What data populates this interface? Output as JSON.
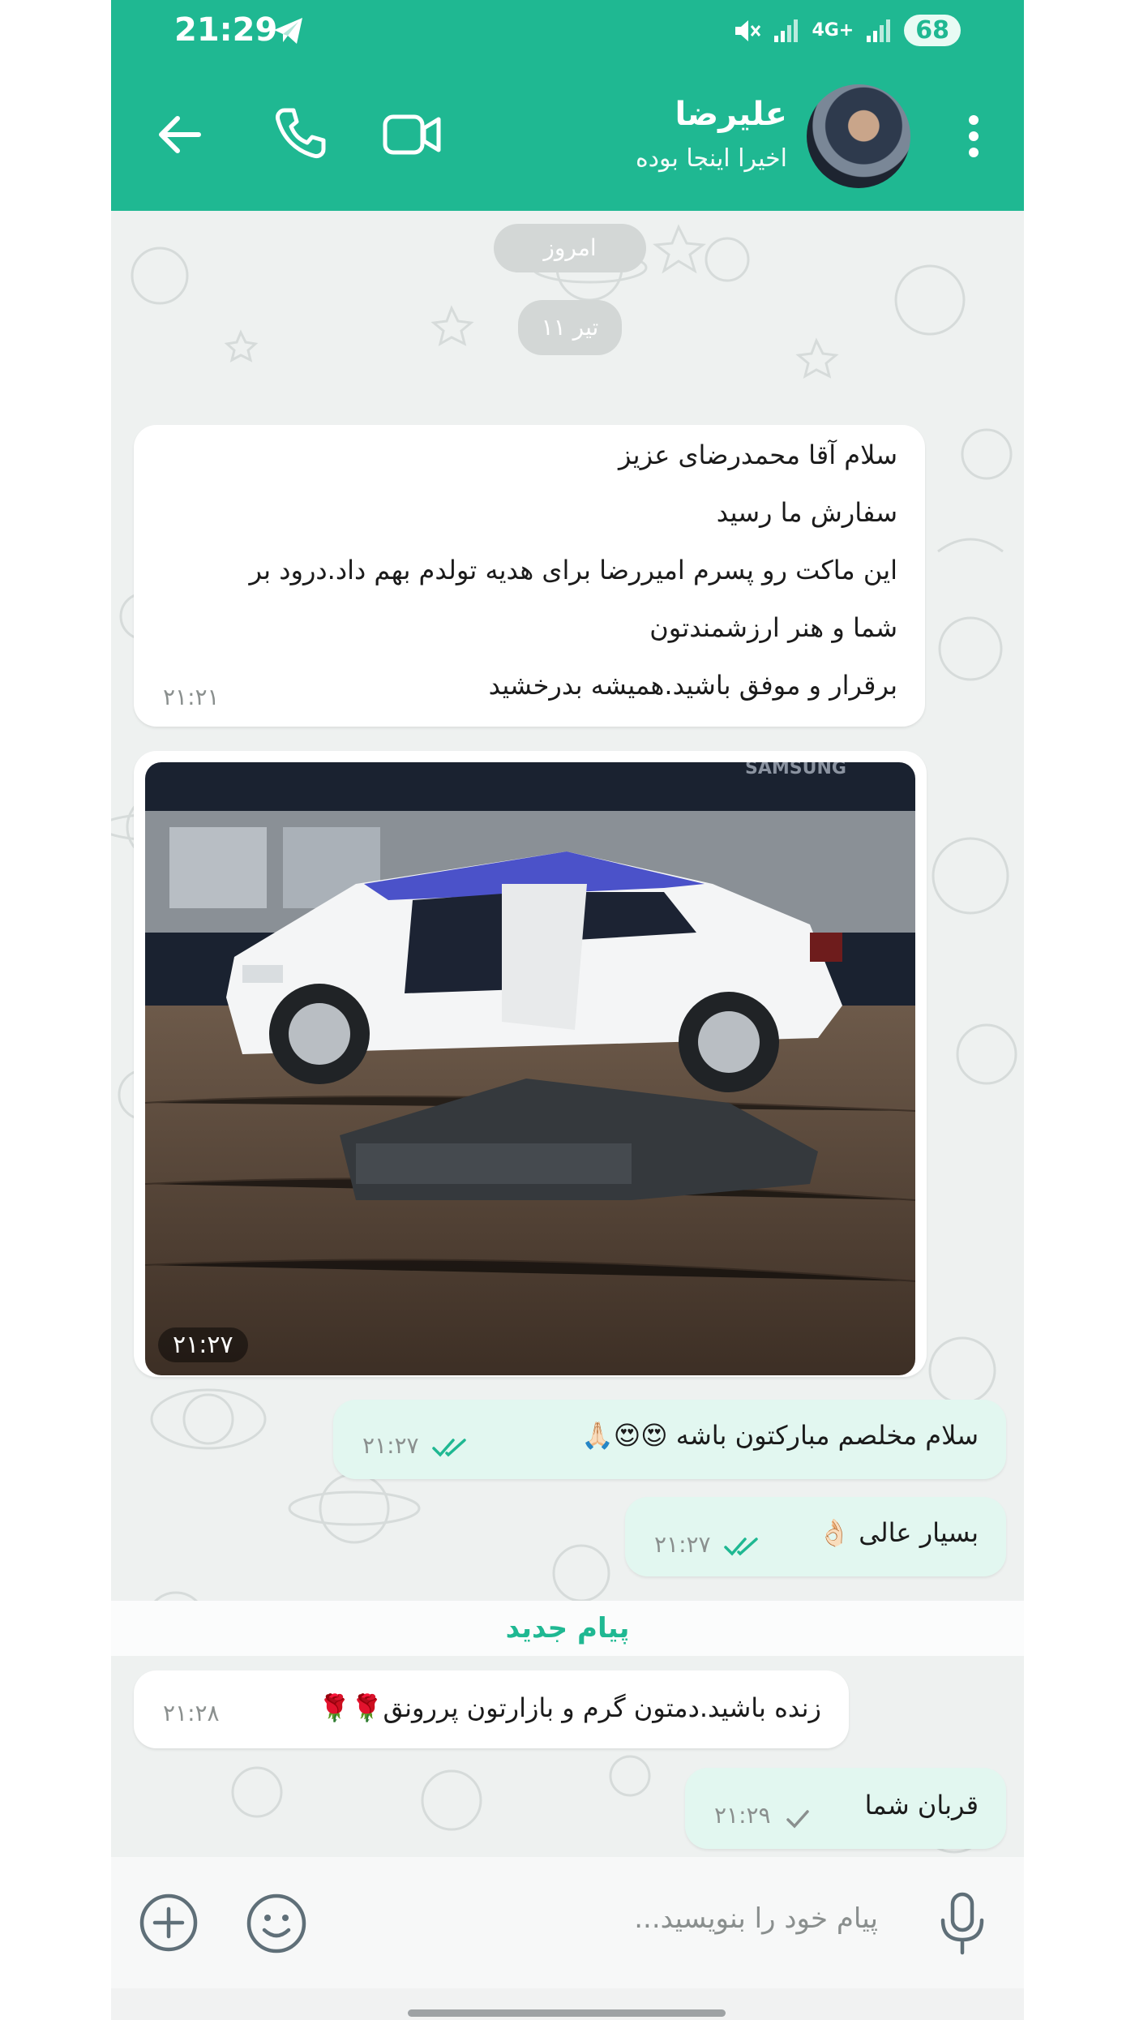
{
  "status_bar": {
    "time": "21:29",
    "battery": "68",
    "network": "4G+"
  },
  "header": {
    "contact_name": "علیرضا",
    "presence": "اخیرا اینجا بوده"
  },
  "date_pills": {
    "today": "امروز",
    "date": "۱۱ تیر"
  },
  "messages": [
    {
      "id": "m1",
      "direction": "in",
      "lines": [
        "سلام آقا محمدرضای عزیز",
        "سفارش ما رسید",
        "این ماکت رو پسرم  امیررضا برای هدیه تولدم بهم داد.درود بر",
        "شما و هنر ارزشمندتون",
        "برقرار و موفق باشید.همیشه بدرخشید"
      ],
      "time": "۲۱:۲۱"
    },
    {
      "id": "m2",
      "direction": "in",
      "type": "photo",
      "caption_time": "۲۱:۲۷",
      "photo_label": "SAMSUNG"
    },
    {
      "id": "m3",
      "direction": "out",
      "text": "سلام مخلصم مبارکتون باشه 😍😍🙏🏻",
      "time": "۲۱:۲۷",
      "status": "read"
    },
    {
      "id": "m4",
      "direction": "out",
      "text": "بسیار عالی 👌🏻",
      "time": "۲۱:۲۷",
      "status": "read"
    },
    {
      "id": "m5",
      "direction": "in",
      "text": "زنده باشید.دمتون گرم و بازارتون پررونق🌹🌹",
      "time": "۲۱:۲۸"
    },
    {
      "id": "m6",
      "direction": "out",
      "text": "قربان شما",
      "time": "۲۱:۲۹",
      "status": "sent"
    }
  ],
  "new_messages_label": "پیام جدید",
  "input": {
    "placeholder": "پیام خود را بنویسید..."
  },
  "colors": {
    "accent": "#1fb892",
    "outgoing_bubble": "#e2f7f0",
    "incoming_bubble": "#ffffff",
    "chat_bg": "#eef1f0"
  },
  "icons": [
    "telegram-icon",
    "mute-icon",
    "signal-icon",
    "back-arrow-icon",
    "phone-icon",
    "video-call-icon",
    "more-vertical-icon",
    "plus-circle-icon",
    "emoji-icon",
    "microphone-icon",
    "double-check-icon",
    "single-check-icon"
  ]
}
